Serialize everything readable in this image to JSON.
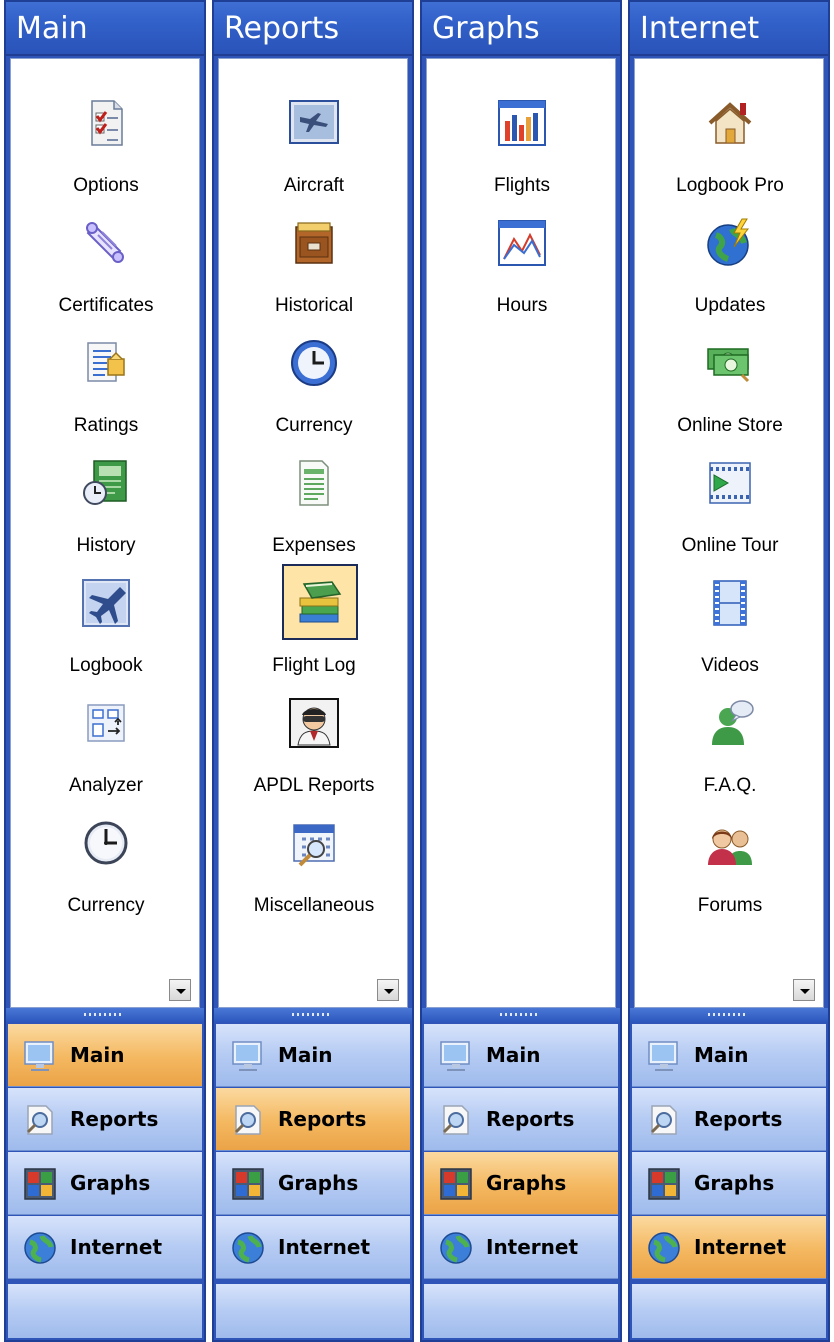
{
  "panels": [
    {
      "title": "Main",
      "items": [
        {
          "label": "Options",
          "icon": "checklist-icon"
        },
        {
          "label": "Certificates",
          "icon": "certificate-scroll-icon"
        },
        {
          "label": "Ratings",
          "icon": "ratings-document-icon"
        },
        {
          "label": "History",
          "icon": "history-icon"
        },
        {
          "label": "Logbook",
          "icon": "airplane-icon"
        },
        {
          "label": "Analyzer",
          "icon": "analyzer-icon"
        },
        {
          "label": "Currency",
          "icon": "clock-icon"
        }
      ],
      "active_nav": "Main"
    },
    {
      "title": "Reports",
      "items": [
        {
          "label": "Aircraft",
          "icon": "aircraft-photo-icon"
        },
        {
          "label": "Historical",
          "icon": "file-cabinet-icon"
        },
        {
          "label": "Currency",
          "icon": "blue-clock-icon"
        },
        {
          "label": "Expenses",
          "icon": "spreadsheet-icon"
        },
        {
          "label": "Flight Log",
          "icon": "books-icon"
        },
        {
          "label": "APDL Reports",
          "icon": "pilot-icon"
        },
        {
          "label": "Miscellaneous",
          "icon": "calendar-search-icon"
        }
      ],
      "active_nav": "Reports",
      "selected_item": "Flight Log"
    },
    {
      "title": "Graphs",
      "items": [
        {
          "label": "Flights",
          "icon": "bar-chart-icon"
        },
        {
          "label": "Hours",
          "icon": "line-chart-icon"
        }
      ],
      "active_nav": "Graphs"
    },
    {
      "title": "Internet",
      "items": [
        {
          "label": "Logbook Pro",
          "icon": "home-icon"
        },
        {
          "label": "Updates",
          "icon": "globe-lightning-icon"
        },
        {
          "label": "Online Store",
          "icon": "money-icon"
        },
        {
          "label": "Online Tour",
          "icon": "film-play-icon"
        },
        {
          "label": "Videos",
          "icon": "film-strip-icon"
        },
        {
          "label": "F.A.Q.",
          "icon": "faq-person-icon"
        },
        {
          "label": "Forums",
          "icon": "people-icon"
        }
      ],
      "active_nav": "Internet"
    }
  ],
  "nav_buttons": [
    {
      "label": "Main",
      "icon": "monitor-icon"
    },
    {
      "label": "Reports",
      "icon": "report-magnifier-icon"
    },
    {
      "label": "Graphs",
      "icon": "graphs-window-icon"
    },
    {
      "label": "Internet",
      "icon": "globe-icon"
    }
  ],
  "colors": {
    "title_bar": "#3161c9",
    "nav_normal": "#b5cbf3",
    "nav_active": "#f4b860",
    "selected_item_bg": "#ffe4a8"
  }
}
